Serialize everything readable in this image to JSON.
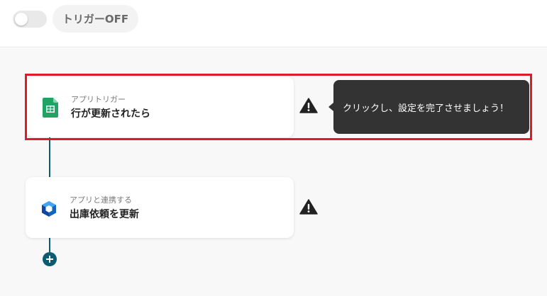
{
  "header": {
    "toggle_state": "off",
    "trigger_label": "トリガーOFF"
  },
  "flow": {
    "steps": [
      {
        "kicker": "アプリトリガー",
        "title": "行が更新されたら",
        "icon": "google-sheets-icon",
        "status_icon": "warning-icon"
      },
      {
        "kicker": "アプリと連携する",
        "title": "出庫依頼を更新",
        "icon": "cube-app-icon",
        "status_icon": "warning-icon"
      }
    ],
    "tooltip": "クリックし、設定を完了させましょう！",
    "add_icon": "plus-icon"
  },
  "colors": {
    "highlight_border": "#e01b24",
    "connector": "#0b5c73",
    "tooltip_bg": "#333333",
    "sheets_green": "#1fa463",
    "cube_blue": "#1565c0"
  }
}
